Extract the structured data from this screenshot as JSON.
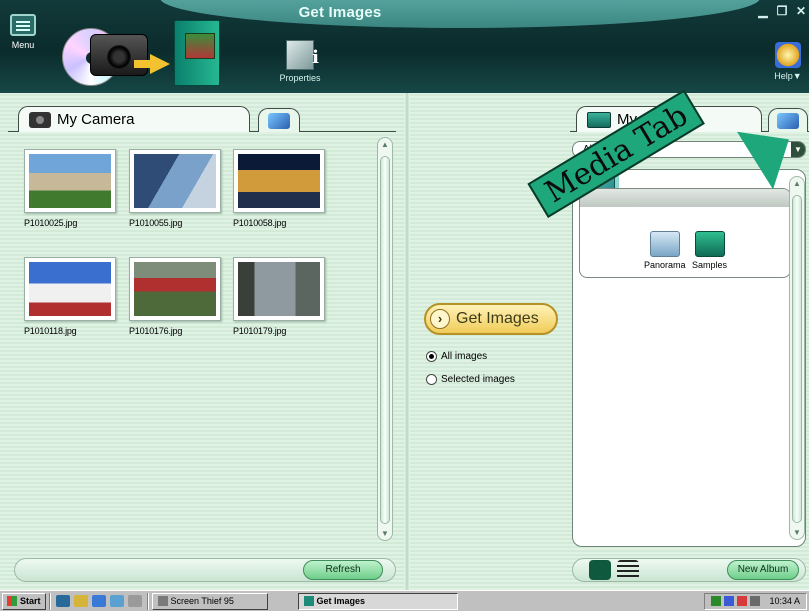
{
  "window": {
    "title": "Get Images",
    "controls": [
      "minimize-icon",
      "restore-icon",
      "close-icon"
    ]
  },
  "header": {
    "menu_label": "Menu",
    "properties_label": "Properties",
    "help_label": "Help▼"
  },
  "camera_panel": {
    "tab_label": "My Camera",
    "images": [
      {
        "filename": "P1010025.jpg",
        "colors": [
          "#6fa5d8",
          "#c8b89a",
          "#3f7a2f"
        ]
      },
      {
        "filename": "P1010055.jpg",
        "colors": [
          "#2f4c76",
          "#7aa1c9",
          "#c5d3e0"
        ]
      },
      {
        "filename": "P1010058.jpg",
        "colors": [
          "#0b1a36",
          "#d19a3a",
          "#1f2f4c"
        ]
      },
      {
        "filename": "P1010118.jpg",
        "colors": [
          "#3a6fcf",
          "#f0f0f0",
          "#b22f2f"
        ]
      },
      {
        "filename": "P1010176.jpg",
        "colors": [
          "#7e8d7a",
          "#b03030",
          "#4e6a3b"
        ]
      },
      {
        "filename": "P1010179.jpg",
        "colors": [
          "#8e9aa0",
          "#3a3f3a",
          "#5c6660"
        ]
      }
    ],
    "refresh_label": "Refresh"
  },
  "transfer": {
    "get_images_label": "Get Images",
    "options": [
      {
        "label": "All images",
        "selected": true
      },
      {
        "label": "Selected images",
        "selected": false
      }
    ]
  },
  "albums_panel": {
    "tab_label": "My Albums",
    "album_select": "Album",
    "items": [
      {
        "label": "Panorama",
        "icon": "panorama-icon"
      },
      {
        "label": "Samples",
        "icon": "samples-album-icon"
      }
    ],
    "new_album_label": "New Album"
  },
  "annotation": {
    "callout_text": "Media Tab"
  },
  "taskbar": {
    "start_label": "Start",
    "tasks": [
      {
        "label": "Screen Thief 95",
        "active": false
      },
      {
        "label": "Get Images",
        "active": true
      }
    ],
    "clock": "10:34 A"
  },
  "colors": {
    "header_dark": "#0b2b2c",
    "panel_bg": "#d7ecdc",
    "get_button": "#f0cc58",
    "pill_button": "#6fce8b",
    "callout": "#1ea77a"
  }
}
